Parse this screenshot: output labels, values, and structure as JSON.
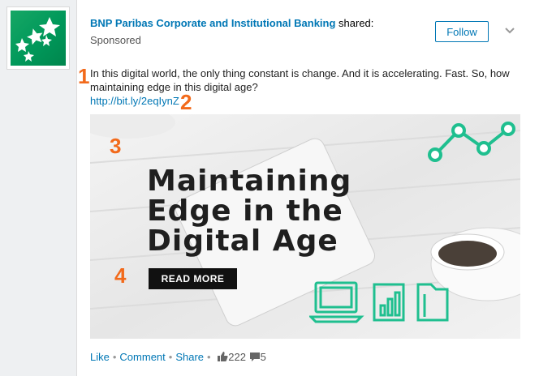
{
  "post": {
    "company_name": "BNP Paribas Corporate and Institutional Banking",
    "shared_suffix": " shared:",
    "sponsored": "Sponsored",
    "follow_label": "Follow",
    "text": "In this digital world, the only thing constant is change. And it is accelerating. Fast. So, how maintaining edge in this digital age?",
    "link": "http://bit.ly/2eqIynZ"
  },
  "ad": {
    "headline_lines": [
      "Maintaining",
      "Edge in the",
      "Digital Age"
    ],
    "cta": "READ MORE"
  },
  "markers": [
    "1",
    "2",
    "3",
    "4"
  ],
  "social": {
    "like": "Like",
    "comment": "Comment",
    "share": "Share",
    "separator": "•",
    "likes_count": "222",
    "comments_count": "5"
  },
  "colors": {
    "brand_green": "#00985a",
    "link_blue": "#0077b5",
    "marker_orange": "#f26a1b",
    "icon_teal": "#1fbf8f"
  }
}
